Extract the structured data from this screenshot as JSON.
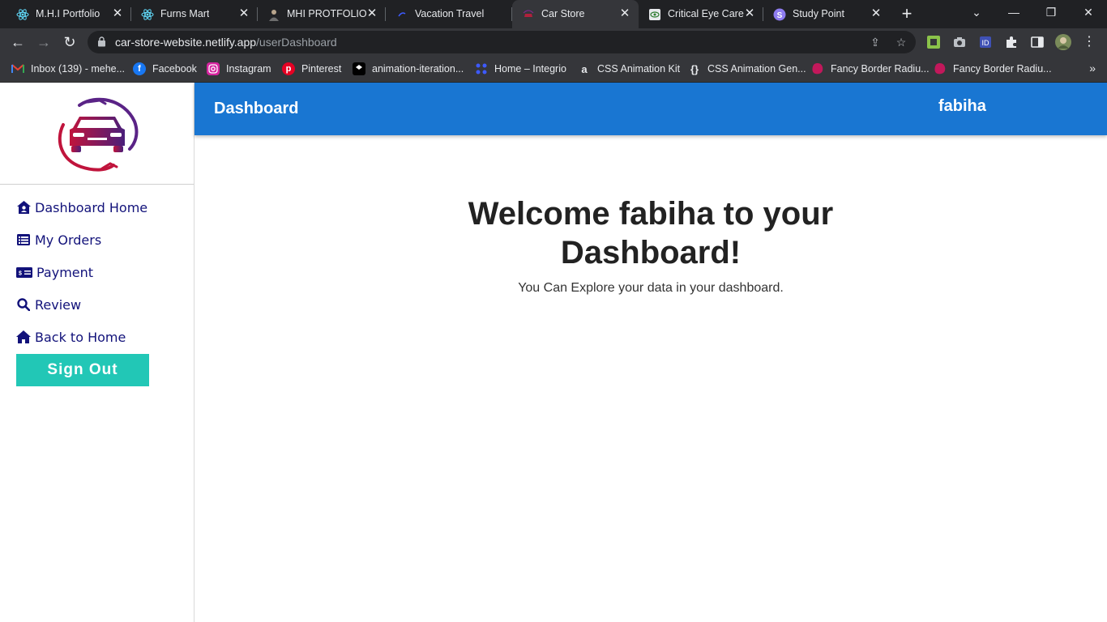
{
  "browser": {
    "tabs": [
      {
        "title": "M.H.I Portfolio",
        "icon": "react-icon",
        "active": false
      },
      {
        "title": "Furns Mart",
        "icon": "react-icon",
        "active": false
      },
      {
        "title": "MHI PROTFOLIO",
        "icon": "person-icon",
        "active": false
      },
      {
        "title": "Vacation Travel",
        "icon": "vacation-icon",
        "active": false
      },
      {
        "title": "Car Store",
        "icon": "car-store-icon",
        "active": true
      },
      {
        "title": "Critical Eye Care",
        "icon": "eye-care-icon",
        "active": false
      },
      {
        "title": "Study Point",
        "icon": "study-point-icon",
        "active": false
      }
    ],
    "url_host": "car-store-website.netlify.app",
    "url_path": "/userDashboard",
    "bookmarks": [
      {
        "label": "Inbox (139) - mehe...",
        "icon": "gmail-icon"
      },
      {
        "label": "Facebook",
        "icon": "facebook-icon"
      },
      {
        "label": "Instagram",
        "icon": "instagram-icon"
      },
      {
        "label": "Pinterest",
        "icon": "pinterest-icon"
      },
      {
        "label": "animation-iteration...",
        "icon": "codepen-icon"
      },
      {
        "label": "Home – Integrio",
        "icon": "integrio-icon"
      },
      {
        "label": "CSS Animation Kit",
        "icon": "animation-kit-icon"
      },
      {
        "label": "CSS Animation Gen...",
        "icon": "braces-icon"
      },
      {
        "label": "Fancy Border Radiu...",
        "icon": "blob-icon"
      },
      {
        "label": "Fancy Border Radiu...",
        "icon": "blob-icon"
      }
    ]
  },
  "sidebar": {
    "items": [
      {
        "label": "Dashboard Home",
        "icon": "house-user-icon"
      },
      {
        "label": "My Orders",
        "icon": "list-icon"
      },
      {
        "label": "Payment",
        "icon": "money-bill-icon"
      },
      {
        "label": "Review",
        "icon": "search-icon"
      },
      {
        "label": "Back to Home",
        "icon": "home-icon"
      }
    ],
    "signout_label": "Sign Out"
  },
  "header": {
    "title": "Dashboard",
    "user": "fabiha"
  },
  "main": {
    "heading": "Welcome fabiha to your Dashboard!",
    "subtext": "You Can Explore your data in your dashboard."
  },
  "colors": {
    "header_bg": "#1976d2",
    "signout_bg": "#22c7b6",
    "nav_text": "#12127a"
  }
}
